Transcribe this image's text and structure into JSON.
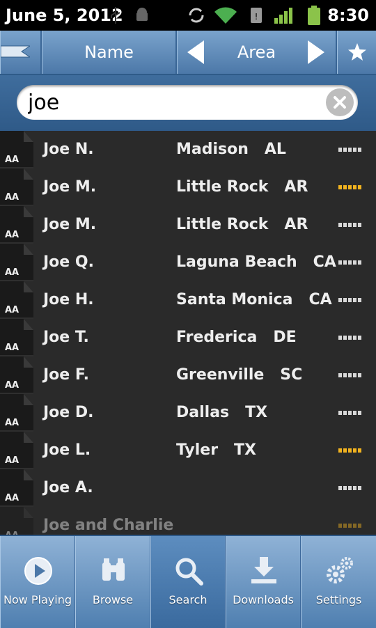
{
  "status_bar": {
    "date": "June 5, 2012",
    "time": "8:30",
    "icons": [
      "usb-icon",
      "android-debug-icon",
      "sync-icon",
      "wifi-icon",
      "sim-icon",
      "signal-icon",
      "battery-icon"
    ]
  },
  "header": {
    "col_name": "Name",
    "col_area": "Area"
  },
  "search": {
    "value": "joe"
  },
  "results": [
    {
      "badge": "AA",
      "name": "Joe N.",
      "area": "Madison   AL",
      "rating_color": "#d8d8d8"
    },
    {
      "badge": "AA",
      "name": "Joe M.",
      "area": "Little Rock   AR",
      "rating_color": "#f2b31f"
    },
    {
      "badge": "AA",
      "name": "Joe M.",
      "area": "Little Rock   AR",
      "rating_color": "#d8d8d8"
    },
    {
      "badge": "AA",
      "name": "Joe Q.",
      "area": "Laguna Beach   CA",
      "rating_color": "#d8d8d8"
    },
    {
      "badge": "AA",
      "name": "Joe H.",
      "area": "Santa Monica   CA",
      "rating_color": "#d8d8d8"
    },
    {
      "badge": "AA",
      "name": "Joe T.",
      "area": "Frederica   DE",
      "rating_color": "#d8d8d8"
    },
    {
      "badge": "AA",
      "name": "Joe F.",
      "area": "Greenville   SC",
      "rating_color": "#d8d8d8"
    },
    {
      "badge": "AA",
      "name": "Joe D.",
      "area": "Dallas   TX",
      "rating_color": "#d8d8d8"
    },
    {
      "badge": "AA",
      "name": "Joe L.",
      "area": "Tyler   TX",
      "rating_color": "#f2b31f"
    },
    {
      "badge": "AA",
      "name": "Joe A.",
      "area": "",
      "rating_color": "#d8d8d8"
    },
    {
      "badge": "AA",
      "name": "Joe and Charlie",
      "area": "",
      "rating_color": "#f2b31f"
    }
  ],
  "tabs": [
    {
      "label": "Now Playing",
      "icon": "play-icon"
    },
    {
      "label": "Browse",
      "icon": "binoculars-icon"
    },
    {
      "label": "Search",
      "icon": "magnifier-icon"
    },
    {
      "label": "Downloads",
      "icon": "download-icon"
    },
    {
      "label": "Settings",
      "icon": "gears-icon"
    }
  ],
  "colors": {
    "accent_blue": "#4c78a8",
    "rating_gold": "#f2b31f"
  }
}
